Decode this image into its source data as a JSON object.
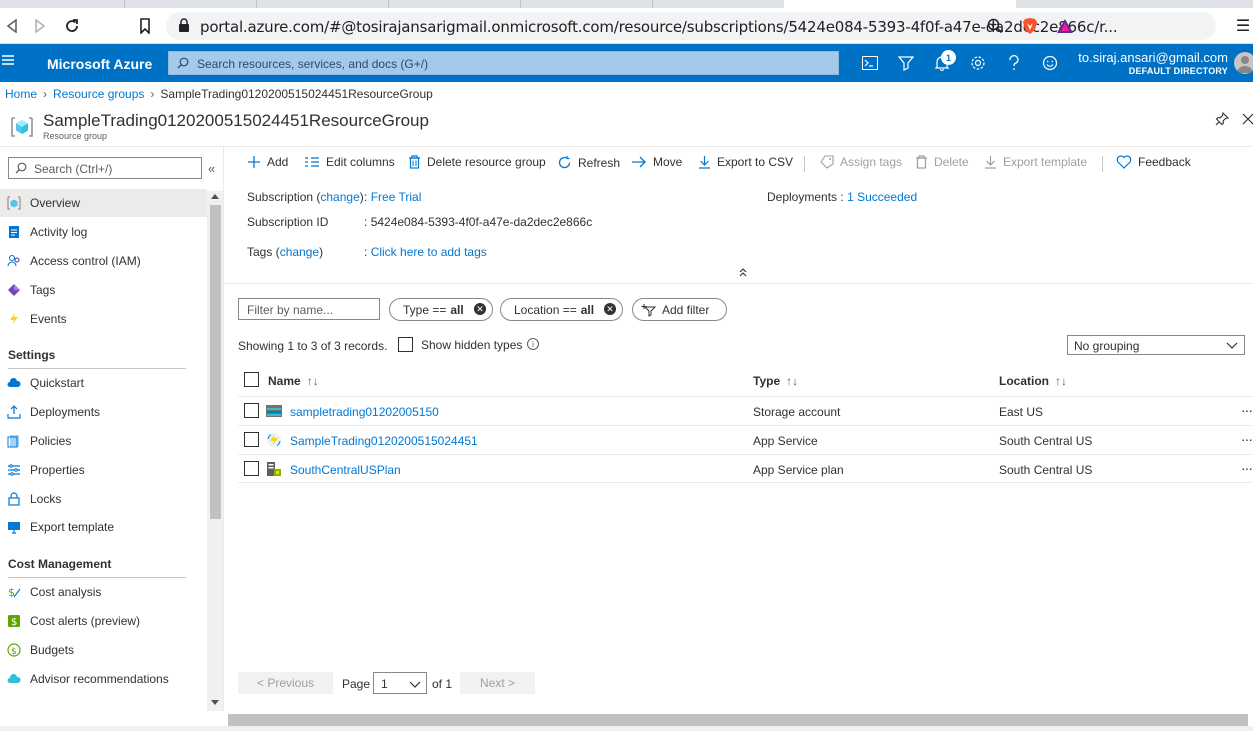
{
  "browser": {
    "url": "portal.azure.com/#@tosirajansarigmail.onmicrosoft.com/resource/subscriptions/5424e084-5393-4f0f-a47e-da2dec2e866c/r..."
  },
  "header": {
    "brand": "Microsoft Azure",
    "search_placeholder": "Search resources, services, and docs (G+/)",
    "notification_count": "1",
    "user_email": "to.siraj.ansari@gmail.com",
    "directory": "DEFAULT DIRECTORY"
  },
  "breadcrumb": {
    "home": "Home",
    "resource_groups": "Resource groups",
    "current": "SampleTrading0120200515024451ResourceGroup"
  },
  "title": {
    "name": "SampleTrading0120200515024451ResourceGroup",
    "subtitle": "Resource group"
  },
  "sidebar": {
    "search_placeholder": "Search (Ctrl+/)",
    "collapse": "«",
    "items": [
      {
        "label": "Overview"
      },
      {
        "label": "Activity log"
      },
      {
        "label": "Access control (IAM)"
      },
      {
        "label": "Tags"
      },
      {
        "label": "Events"
      }
    ],
    "settings_heading": "Settings",
    "settings_items": [
      {
        "label": "Quickstart"
      },
      {
        "label": "Deployments"
      },
      {
        "label": "Policies"
      },
      {
        "label": "Properties"
      },
      {
        "label": "Locks"
      },
      {
        "label": "Export template"
      }
    ],
    "cost_heading": "Cost Management",
    "cost_items": [
      {
        "label": "Cost analysis"
      },
      {
        "label": "Cost alerts (preview)"
      },
      {
        "label": "Budgets"
      },
      {
        "label": "Advisor recommendations"
      }
    ]
  },
  "commands": {
    "add": "Add",
    "edit_columns": "Edit columns",
    "delete_rg": "Delete resource group",
    "refresh": "Refresh",
    "move": "Move",
    "export_csv": "Export to CSV",
    "assign_tags": "Assign tags",
    "delete": "Delete",
    "export_template": "Export template",
    "feedback": "Feedback"
  },
  "essentials": {
    "subscription_label": "Subscription (",
    "change": "change",
    "subscription_label_end": ")",
    "subscription_value": "Free Trial",
    "subscription_id_label": "Subscription ID",
    "subscription_id": "5424e084-5393-4f0f-a47e-da2dec2e866c",
    "tags_label": "Tags (",
    "tags_value": "Click here to add tags",
    "deployments_label": "Deployments",
    "deployments_value": "1 Succeeded",
    "colon": ":"
  },
  "filters": {
    "filter_placeholder": "Filter by name...",
    "type_pill": "Type ==",
    "type_value": "all",
    "location_pill": "Location ==",
    "location_value": "all",
    "add_filter": "Add filter"
  },
  "list": {
    "showing": "Showing 1 to 3 of 3 records.",
    "show_hidden": "Show hidden types",
    "grouping": "No grouping",
    "columns": {
      "name": "Name",
      "type": "Type",
      "location": "Location"
    },
    "rows": [
      {
        "name": "sampletrading01202005150",
        "type": "Storage account",
        "location": "East US"
      },
      {
        "name": "SampleTrading0120200515024451",
        "type": "App Service",
        "location": "South Central US"
      },
      {
        "name": "SouthCentralUSPlan",
        "type": "App Service plan",
        "location": "South Central US"
      }
    ]
  },
  "pager": {
    "previous": "< Previous",
    "page_label": "Page",
    "page_value": "1",
    "of": "of 1",
    "next": "Next >"
  }
}
